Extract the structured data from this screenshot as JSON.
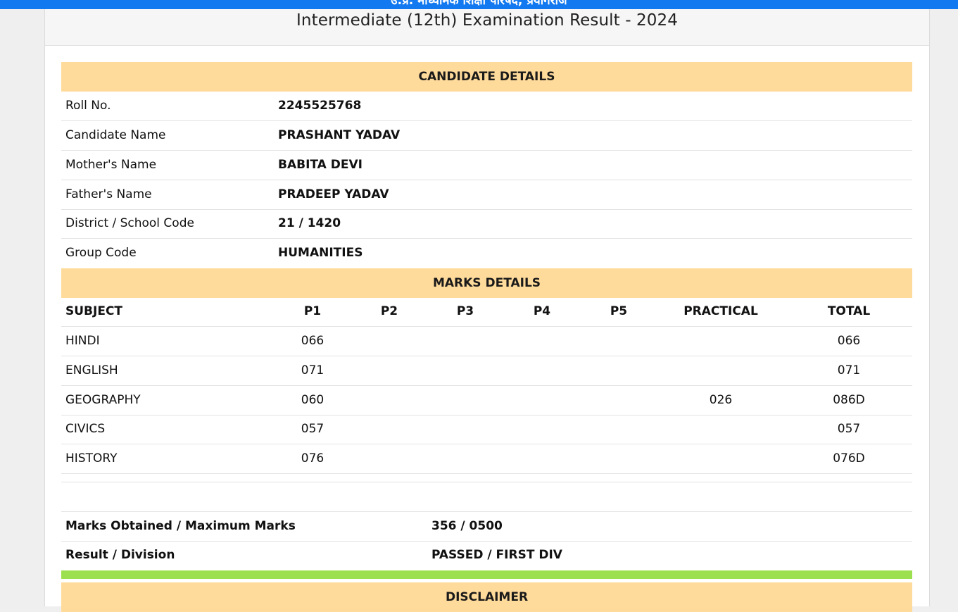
{
  "topbar": {
    "text": "उ.प्र. माध्यमिक शिक्षा परिषद, प्रयागराज"
  },
  "page_title": "Intermediate (12th) Examination Result - 2024",
  "candidate": {
    "heading": "CANDIDATE DETAILS",
    "rows": [
      {
        "label": "Roll No.",
        "value": "2245525768"
      },
      {
        "label": "Candidate Name",
        "value": "PRASHANT YADAV"
      },
      {
        "label": "Mother's Name",
        "value": "BABITA DEVI"
      },
      {
        "label": "Father's Name",
        "value": "PRADEEP YADAV"
      },
      {
        "label": "District / School Code",
        "value": "21 / 1420"
      },
      {
        "label": "Group Code",
        "value": "HUMANITIES"
      }
    ]
  },
  "marks": {
    "heading": "MARKS DETAILS",
    "columns": [
      "SUBJECT",
      "P1",
      "P2",
      "P3",
      "P4",
      "P5",
      "PRACTICAL",
      "TOTAL"
    ],
    "rows": [
      {
        "subject": "HINDI",
        "p1": "066",
        "p2": "",
        "p3": "",
        "p4": "",
        "p5": "",
        "practical": "",
        "total": "066"
      },
      {
        "subject": "ENGLISH",
        "p1": "071",
        "p2": "",
        "p3": "",
        "p4": "",
        "p5": "",
        "practical": "",
        "total": "071"
      },
      {
        "subject": "GEOGRAPHY",
        "p1": "060",
        "p2": "",
        "p3": "",
        "p4": "",
        "p5": "",
        "practical": "026",
        "total": "086D"
      },
      {
        "subject": "CIVICS",
        "p1": "057",
        "p2": "",
        "p3": "",
        "p4": "",
        "p5": "",
        "practical": "",
        "total": "057"
      },
      {
        "subject": "HISTORY",
        "p1": "076",
        "p2": "",
        "p3": "",
        "p4": "",
        "p5": "",
        "practical": "",
        "total": "076D"
      }
    ]
  },
  "summary": {
    "marks_label": "Marks Obtained / Maximum Marks",
    "marks_value": "356 / 0500",
    "result_label": "Result / Division",
    "result_value": "PASSED / FIRST DIV"
  },
  "disclaimer": {
    "heading": "DISCLAIMER"
  },
  "colors": {
    "topbar": "#1279f0",
    "section_header": "#ffdb9b",
    "status_bar": "#9de04f"
  }
}
